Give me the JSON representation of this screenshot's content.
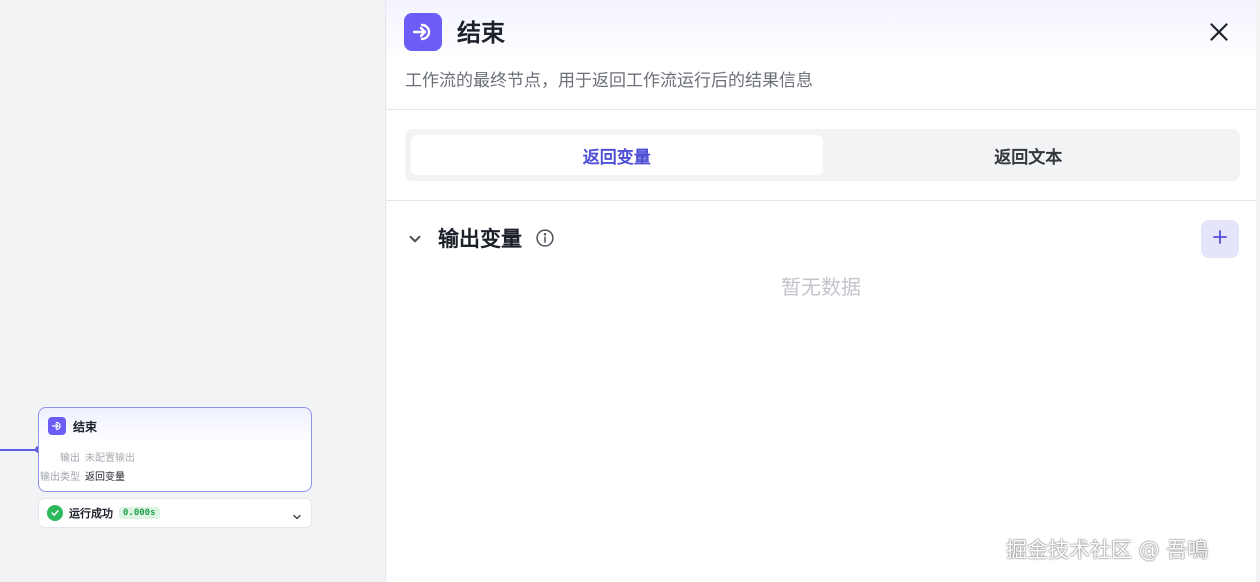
{
  "canvas": {
    "node": {
      "title": "结束",
      "icon": "end-node-icon",
      "rows": [
        {
          "label": "输出",
          "value": "未配置输出"
        },
        {
          "label": "输出类型",
          "value": "返回变量"
        }
      ]
    },
    "status": {
      "text": "运行成功",
      "time": "0.000s",
      "color": "#2eb85c"
    }
  },
  "panel": {
    "title": "结束",
    "description": "工作流的最终节点，用于返回工作流运行后的结果信息",
    "tabs": [
      {
        "label": "返回变量",
        "active": true
      },
      {
        "label": "返回文本",
        "active": false
      }
    ],
    "section": {
      "title": "输出变量",
      "empty_text": "暂无数据"
    }
  },
  "watermark": "掘金技术社区 @ 吾鳴",
  "colors": {
    "accent": "#6b5df5",
    "tab_active": "#4f4fd6",
    "success": "#2eb85c"
  }
}
